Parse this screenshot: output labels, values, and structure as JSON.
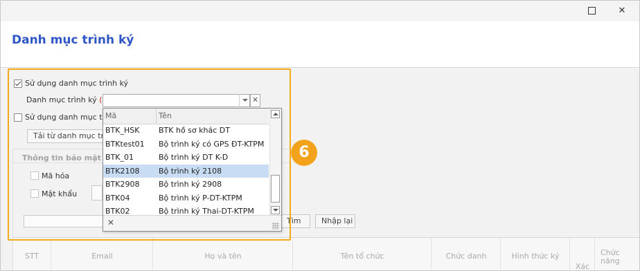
{
  "window": {
    "maximize_icon": "maximize-icon",
    "close_icon": "close-icon",
    "close_glyph": "✕"
  },
  "page_title": "Danh mục trình ký",
  "form": {
    "use_category_label": "Sử dụng danh mục trình ký",
    "use_category_checked": true,
    "category_label": "Danh mục trình ký",
    "required_mark": "(*)",
    "combo_value": "",
    "combo_clear_glyph": "✕",
    "use_category2_label": "Sử dụng danh mục trình",
    "use_category2_checked": false,
    "load_button": "Tải từ danh mục trìn"
  },
  "security": {
    "title": "Thông tin bảo mật",
    "encrypt_label": "Mã hóa",
    "password_label": "Mật khẩu"
  },
  "dropdown": {
    "col_code": "Mã",
    "col_name": "Tên",
    "rows": [
      {
        "code": "BTK_HSK",
        "name": "BTK hồ sơ khác DT"
      },
      {
        "code": "BTKtest01",
        "name": "Bộ trình ký có GPS ĐT-KTPM"
      },
      {
        "code": "BTK_01",
        "name": "Bộ trình ký DT K-D"
      },
      {
        "code": "BTK2108",
        "name": "Bộ trình ký 2108"
      },
      {
        "code": "BTK2908",
        "name": "Bộ trình ký 2908"
      },
      {
        "code": "BTK04",
        "name": "Bộ trình ký P-DT-KTPM"
      },
      {
        "code": "BTK02",
        "name": "Bộ trình ký Thai-DT-KTPM"
      }
    ],
    "selected_index": 3,
    "close_glyph": "✕"
  },
  "search": {
    "find_button": "Tìm",
    "reset_button": "Nhập lại"
  },
  "step_badge": "6",
  "table": {
    "columns": [
      "STT",
      "Email",
      "Họ và tên",
      "Tên tổ chức",
      "Chức danh",
      "Hình thức ký",
      "Xác",
      "Chức năng"
    ]
  },
  "colors": {
    "accent": "#f2a91b",
    "title": "#2e56c7",
    "selected_row": "#c8ddf3",
    "required": "#d62222"
  }
}
